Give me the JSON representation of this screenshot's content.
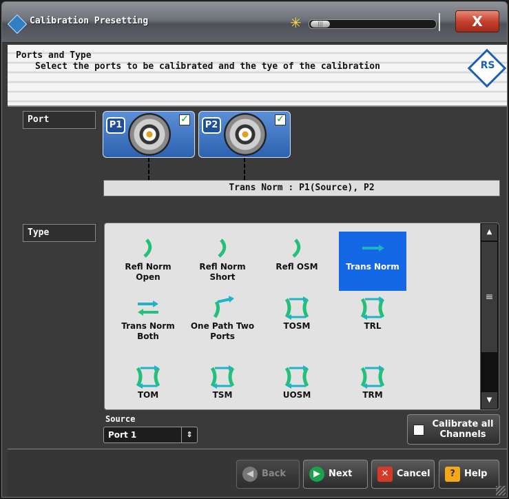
{
  "window": {
    "title": "Calibration Presetting",
    "close_label": "X"
  },
  "banner": {
    "title": "Ports and Type",
    "subtitle": "Select the ports to be calibrated and the tye of the calibration",
    "logo_text": "RS"
  },
  "ports": {
    "section_label": "Port",
    "items": [
      {
        "label": "P1",
        "checked": true
      },
      {
        "label": "P2",
        "checked": true
      }
    ],
    "mode_text": "Trans Norm : P1(Source), P2"
  },
  "types": {
    "section_label": "Type",
    "items": [
      {
        "label": "Refl Norm Open",
        "icon": "refl-arc-icon",
        "selected": false
      },
      {
        "label": "Refl Norm Short",
        "icon": "refl-arc-icon",
        "selected": false
      },
      {
        "label": "Refl OSM",
        "icon": "refl-arc-icon",
        "selected": false
      },
      {
        "label": "Trans Norm",
        "icon": "right-arrow-icon",
        "selected": true
      },
      {
        "label": "Trans Norm Both",
        "icon": "bidirectional-arrow-icon",
        "selected": false
      },
      {
        "label": "One Path Two Ports",
        "icon": "one-path-icon",
        "selected": false
      },
      {
        "label": "TOSM",
        "icon": "full-twoport-icon",
        "selected": false
      },
      {
        "label": "TRL",
        "icon": "full-twoport-icon",
        "selected": false
      },
      {
        "label": "TOM",
        "icon": "full-twoport-icon",
        "selected": false
      },
      {
        "label": "TSM",
        "icon": "full-twoport-icon",
        "selected": false
      },
      {
        "label": "UOSM",
        "icon": "full-twoport-icon",
        "selected": false
      },
      {
        "label": "TRM",
        "icon": "full-twoport-icon",
        "selected": false
      }
    ]
  },
  "source": {
    "label": "Source",
    "value": "Port 1"
  },
  "calibrate_all": {
    "label": "Calibrate all Channels",
    "checked": false
  },
  "buttons": {
    "back": "Back",
    "next": "Next",
    "cancel": "Cancel",
    "help": "Help"
  },
  "colors": {
    "selection": "#1468e6",
    "port_blue": "#2d62b0",
    "icon_green": "#22c07a",
    "icon_cyan": "#1fb3c6"
  }
}
